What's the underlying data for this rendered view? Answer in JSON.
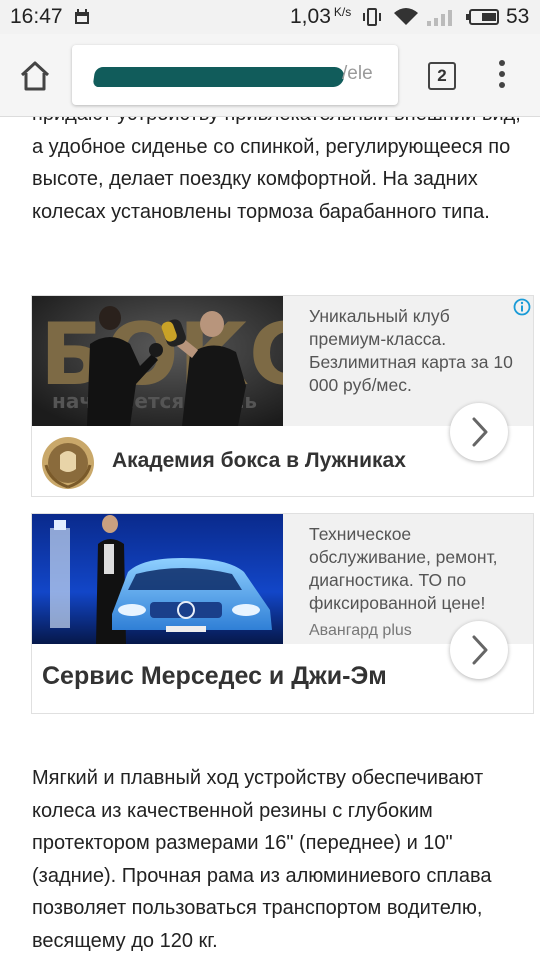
{
  "status_bar": {
    "time": "16:47",
    "net_speed": "1,03",
    "net_speed_unit": "K/s",
    "battery_percent": "53"
  },
  "browser": {
    "url_visible_fragment": "/ele",
    "tab_count": "2"
  },
  "article": {
    "paragraph_top_cut": "придают устройству привлекательный внешний вид, а удобное сиденье со спинкой, регулирующееся по высоте, делает поездку комфортной. На задних колесах установлены тормоза барабанного типа.",
    "paragraph_bottom": "Мягкий и плавный ход устройству обеспечивают колеса из качественной резины с глубоким протектором размерами 16\" (переднее) и 10\" (задние). Прочная рама из алюминиевого сплава позволяет пользоваться транспортом водителю, весящему до 120 кг."
  },
  "ads": [
    {
      "image_text": "БОКС",
      "image_subtext": "начинается здесь",
      "description": "Уникальный клуб премиум-класса. Безлимитная карта за 10 000 руб/мес.",
      "title": "Академия бокса в Лужниках"
    },
    {
      "description": "Техническое обслуживание, ремонт, диагностика. ТО по фиксированной цене!",
      "source": "Авангард plus",
      "title": "Сервис Мерседес и Джи-Эм"
    }
  ],
  "colors": {
    "accent_info": "#1a9bd7",
    "url_scribble": "#115c5b"
  }
}
